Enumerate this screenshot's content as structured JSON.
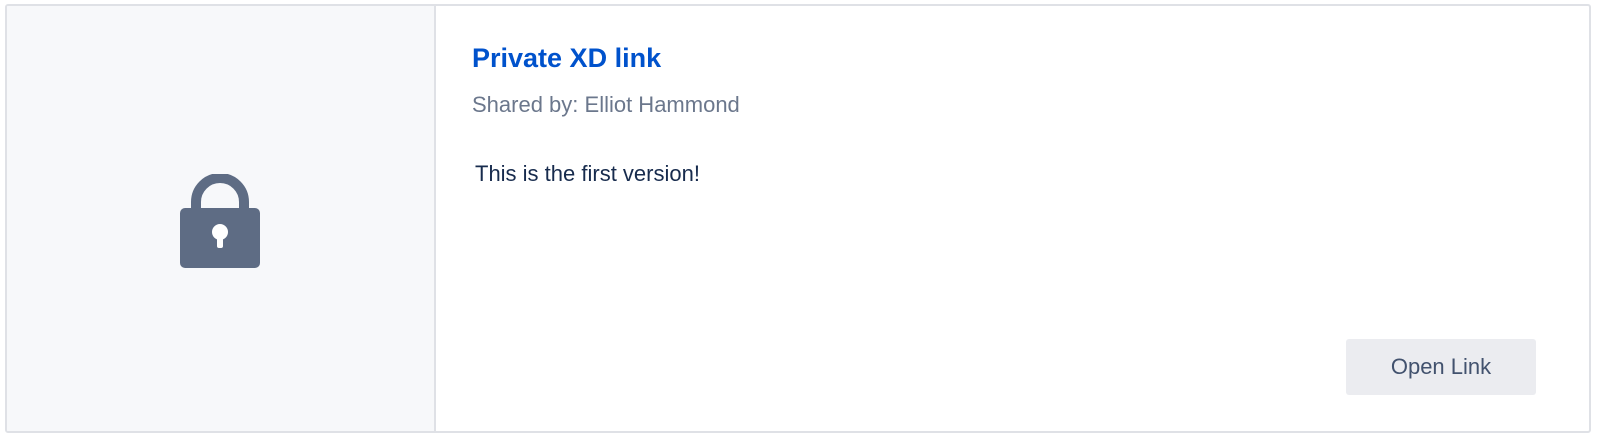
{
  "card": {
    "title": "Private XD link",
    "shared_by": "Shared by: Elliot Hammond",
    "description": "This is the first version!",
    "open_button_label": "Open Link",
    "thumbnail_icon": "lock-icon"
  },
  "colors": {
    "title": "#0052cc",
    "secondary_text": "#6b778c",
    "body_text": "#172b4d",
    "icon": "#5e6c84",
    "thumbnail_bg": "#f7f8fa",
    "border": "#dfe1e6",
    "button_bg": "#ebecf0",
    "button_text": "#42526e"
  }
}
